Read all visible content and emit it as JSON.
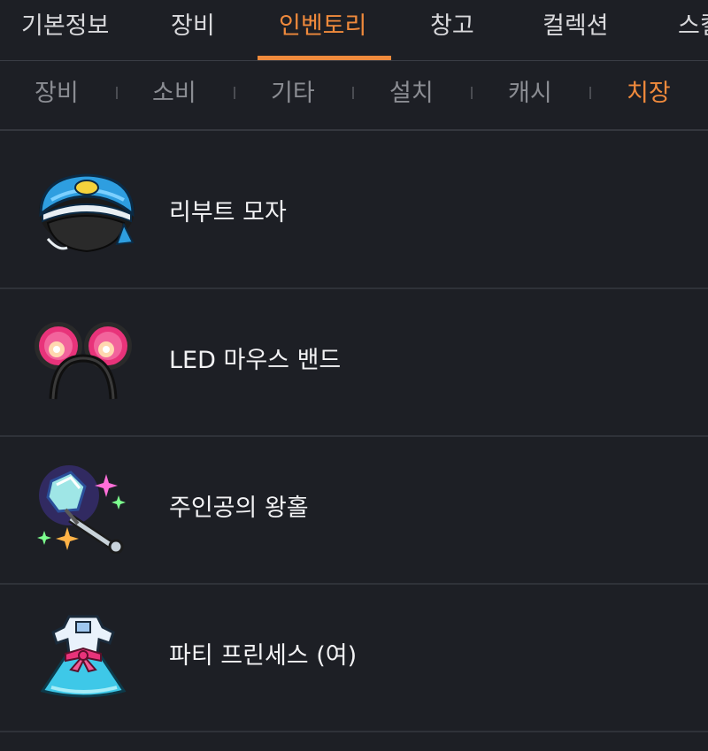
{
  "top_tabs": [
    {
      "label": "기본정보"
    },
    {
      "label": "장비"
    },
    {
      "label": "인벤토리"
    },
    {
      "label": "창고"
    },
    {
      "label": "컬렉션"
    },
    {
      "label": "스킬"
    }
  ],
  "active_top_tab": "인벤토리",
  "sub_tabs": [
    {
      "label": "장비"
    },
    {
      "label": "소비"
    },
    {
      "label": "기타"
    },
    {
      "label": "설치"
    },
    {
      "label": "캐시"
    },
    {
      "label": "치장"
    }
  ],
  "active_sub_tab": "치장",
  "items": [
    {
      "name": "리부트 모자",
      "icon": "blue-cap-icon"
    },
    {
      "name": "LED 마우스 밴드",
      "icon": "mouse-ear-headband-icon"
    },
    {
      "name": "주인공의 왕홀",
      "icon": "sparkling-scepter-icon"
    },
    {
      "name": "파티 프린세스 (여)",
      "icon": "princess-dress-icon"
    }
  ],
  "colors": {
    "background": "#1d1f25",
    "accent": "#f08a3c",
    "inactive_text": "#8b8d93"
  }
}
